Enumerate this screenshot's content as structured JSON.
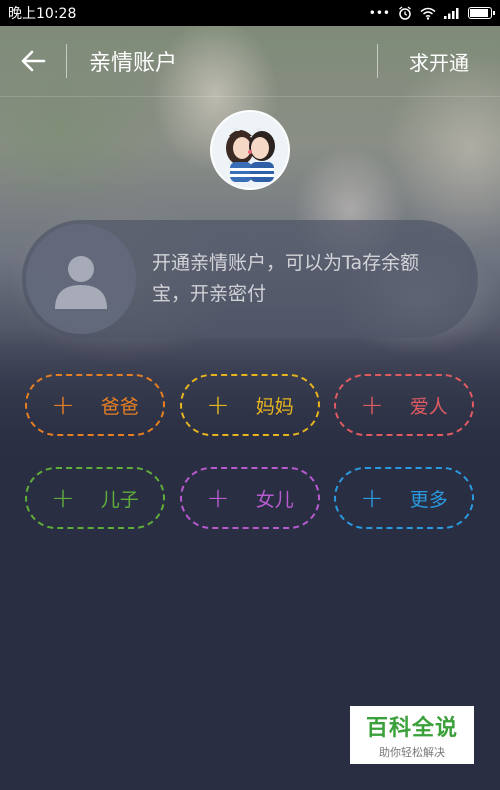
{
  "status_bar": {
    "time": "晚上10:28",
    "dots": "•••"
  },
  "header": {
    "title": "亲情账户",
    "action_label": "求开通"
  },
  "info_card": {
    "text": "开通亲情账户，可以为Ta存余额宝，开亲密付"
  },
  "relations": [
    {
      "label": "爸爸",
      "color": "#e67e22"
    },
    {
      "label": "妈妈",
      "color": "#e5b41f"
    },
    {
      "label": "爱人",
      "color": "#e05a62"
    },
    {
      "label": "儿子",
      "color": "#5fae3a"
    },
    {
      "label": "女儿",
      "color": "#b85ad0"
    },
    {
      "label": "更多",
      "color": "#2a9ae0"
    }
  ],
  "relation_plus": "+",
  "watermark": {
    "main": "百科全说",
    "sub": "助你轻松解决"
  },
  "colors": {
    "background": "#2a2e42",
    "status_bar": "#000000"
  },
  "icons": {
    "back": "back-arrow-icon",
    "alarm": "alarm-icon",
    "wifi": "wifi-icon",
    "signal": "signal-icon",
    "battery": "battery-icon",
    "person": "person-icon"
  }
}
